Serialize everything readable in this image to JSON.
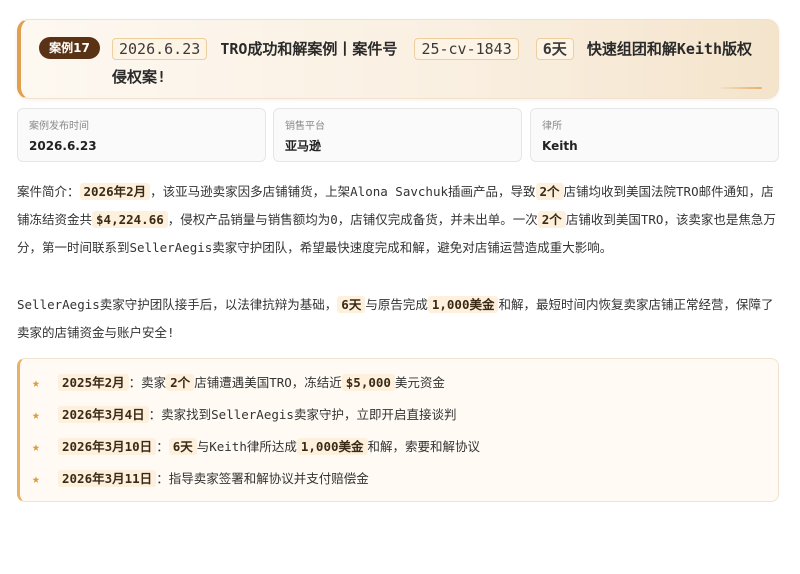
{
  "header": {
    "badge": "案例17",
    "date": "2026.6.23",
    "title_part1": "TRO成功和解案例丨案件号",
    "case_no": "25-cv-1843",
    "days": "6天",
    "title_part2": "快速组团和解Keith版权侵权案!"
  },
  "info": [
    {
      "label": "案例发布时间",
      "value": "2026.6.23"
    },
    {
      "label": "销售平台",
      "value": "亚马逊"
    },
    {
      "label": "律所",
      "value": "Keith"
    }
  ],
  "intro": {
    "t1": "案件简介：",
    "h1": "2026年2月",
    "t2": "，该亚马逊卖家因多店铺铺货，上架Alona Savchuk插画产品，导致",
    "h2": "2个",
    "t3": "店铺均收到美国法院TRO邮件通知，店铺冻结资金共",
    "h3": "$4,224.66",
    "t4": "，侵权产品销量与销售额均为0，店铺仅完成备货，并未出单。一次",
    "h4": "2个",
    "t5": "店铺收到美国TRO，该卖家也是焦急万分，第一时间联系到SellerAegis卖家守护团队，希望最快速度完成和解，避免对店铺运营造成重大影响。"
  },
  "result": {
    "t1": "SellerAegis卖家守护团队接手后，以法律抗辩为基础，",
    "h1": "6天",
    "t2": "与原告完成",
    "h2": "1,000美金",
    "t3": "和解，最短时间内恢复卖家店铺正常经营，保障了卖家的店铺资金与账户安全!"
  },
  "timeline": [
    {
      "date": "2025年2月",
      "t1": "：卖家",
      "h1": "2个",
      "t2": "店铺遭遇美国TRO，冻结近",
      "h2": "$5,000",
      "t3": "美元资金"
    },
    {
      "date": "2026年3月4日",
      "t1": "：卖家找到SellerAegis卖家守护，立即开启直接谈判",
      "h1": "",
      "t2": "",
      "h2": "",
      "t3": ""
    },
    {
      "date": "2026年3月10日",
      "t1": "：",
      "h1": "6天",
      "t2": "与Keith律所达成",
      "h2": "1,000美金",
      "t3": "和解，索要和解协议"
    },
    {
      "date": "2026年3月11日",
      "t1": "：指导卖家签署和解协议并支付赔偿金",
      "h1": "",
      "t2": "",
      "h2": "",
      "t3": ""
    }
  ],
  "icons": {
    "timeline_bullet": "star-icon"
  },
  "colors": {
    "accent": "#e0a04f",
    "badge_bg": "#5a3317",
    "highlight_bg": "#fdf0dc"
  }
}
